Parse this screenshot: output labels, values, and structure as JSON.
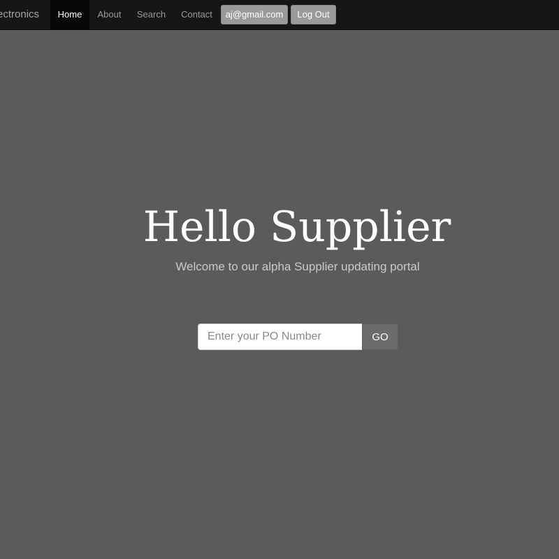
{
  "navbar": {
    "brand": "ectronics",
    "items": [
      {
        "label": "Home",
        "active": true
      },
      {
        "label": "About",
        "active": false
      },
      {
        "label": "Search",
        "active": false
      },
      {
        "label": "Contact",
        "active": false
      }
    ],
    "user_email": "aj@gmail.com",
    "logout_label": "Log Out"
  },
  "hero": {
    "title": "Hello Supplier",
    "subtitle": "Welcome to our alpha Supplier updating portal"
  },
  "po_search": {
    "placeholder": "Enter your PO Number",
    "value": "",
    "button_label": "GO"
  },
  "colors": {
    "page_background": "#5b5b5b",
    "navbar_background": "#161616",
    "active_nav_background": "#070707",
    "button_gray": "#9a9a9a"
  }
}
